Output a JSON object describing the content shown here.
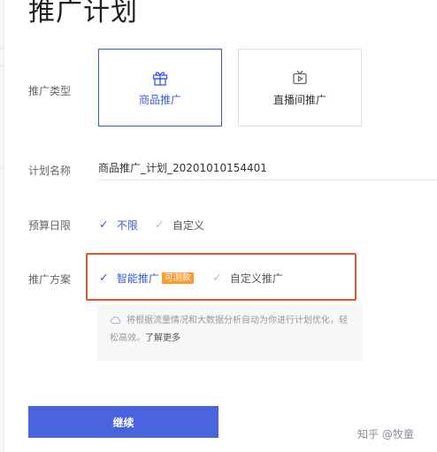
{
  "page": {
    "title": "推广计划"
  },
  "form": {
    "promo_type": {
      "label": "推广类型",
      "options": [
        {
          "label": "商品推广",
          "icon": "gift-icon",
          "selected": true
        },
        {
          "label": "直播间推广",
          "icon": "tv-icon",
          "selected": false
        }
      ]
    },
    "plan_name": {
      "label": "计划名称",
      "value": "商品推广_计划_20201010154401"
    },
    "budget": {
      "label": "预算日限",
      "options": [
        {
          "label": "不限",
          "selected": true
        },
        {
          "label": "自定义",
          "selected": false
        }
      ]
    },
    "scheme": {
      "label": "推广方案",
      "options": [
        {
          "label": "智能推广",
          "badge": "可测款",
          "selected": true
        },
        {
          "label": "自定义推广",
          "selected": false
        }
      ],
      "tip": "将根据流量情况和大数据分析自动为你进行计划优化，轻松高效。",
      "learn_more": "了解更多"
    }
  },
  "actions": {
    "continue_label": "继续"
  },
  "watermark": "知乎 @牧童",
  "colors": {
    "accent": "#3b5bd6",
    "button": "#4a64e0",
    "badge": "#ff9a2e",
    "highlight": "#e0552e"
  }
}
